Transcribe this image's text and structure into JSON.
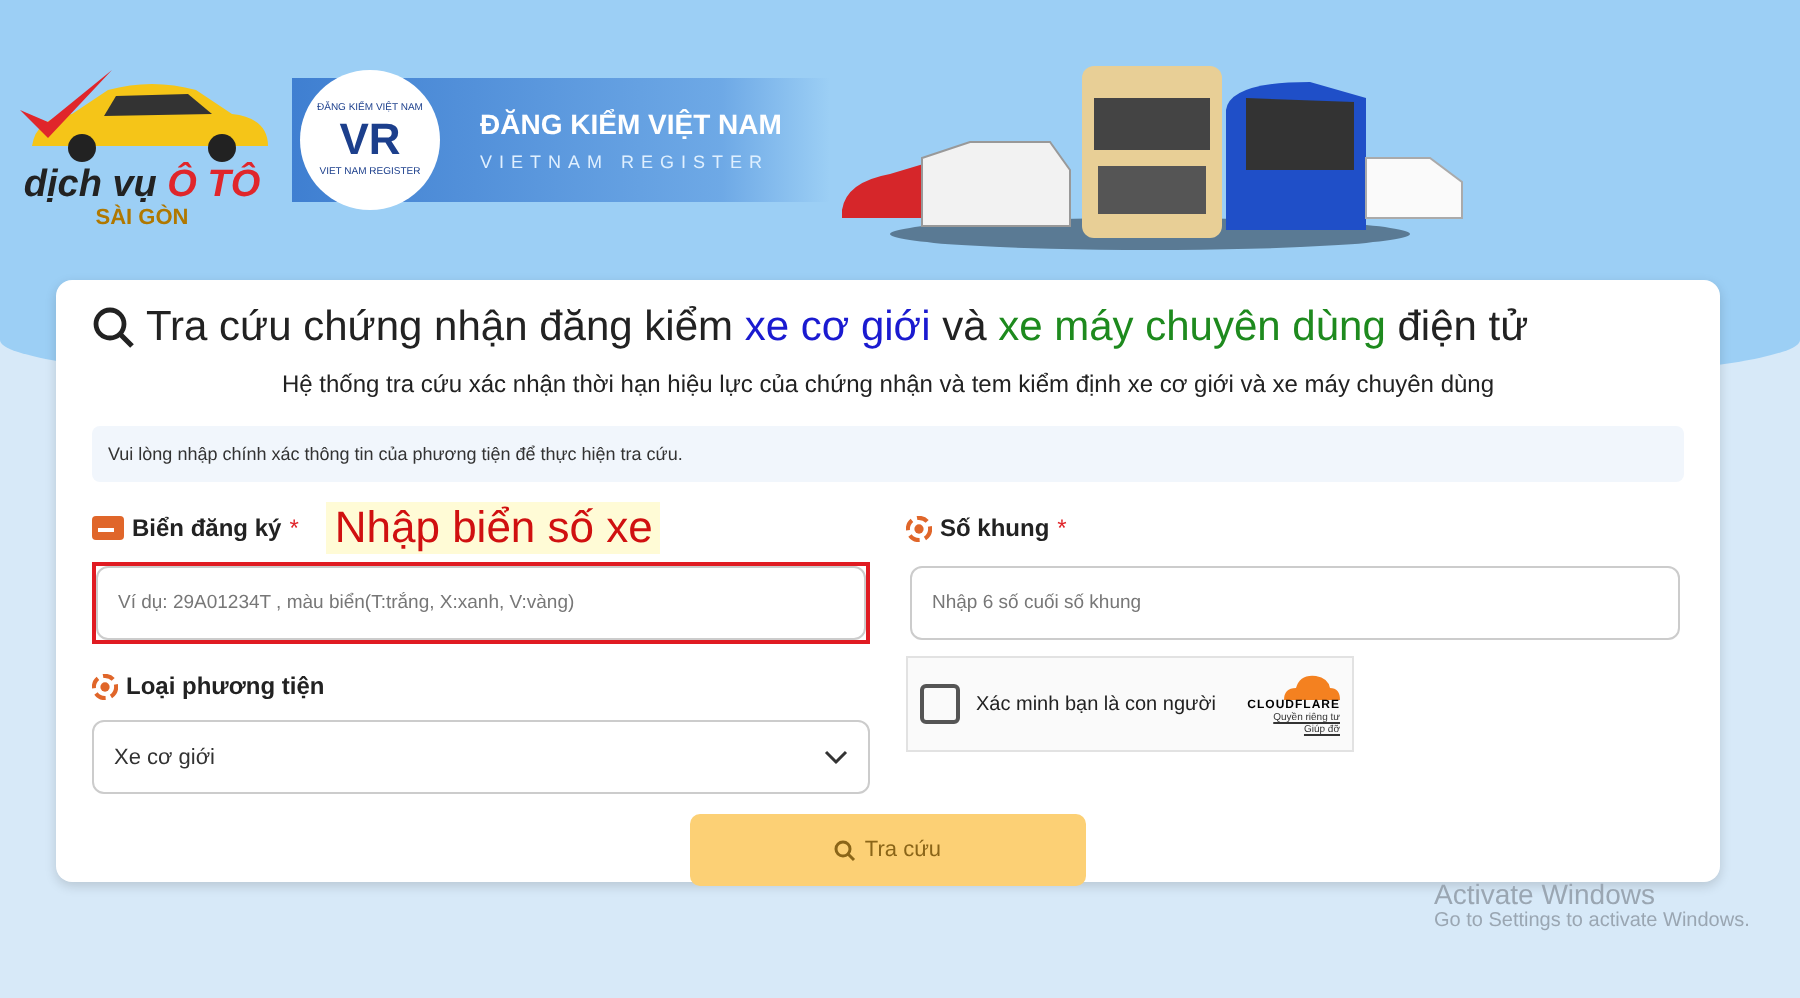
{
  "header": {
    "brand_logo": {
      "line1_a": "dịch vụ",
      "line1_b": "Ô TÔ",
      "line2": "SÀI GÒN"
    },
    "register_logo": {
      "seal_top": "ĐĂNG KIỂM VIỆT NAM",
      "seal_bottom": "VIET NAM REGISTER",
      "seal_mark": "VR",
      "title": "ĐĂNG KIỂM VIỆT NAM",
      "subtitle": "VIETNAM REGISTER"
    }
  },
  "card": {
    "title": [
      {
        "text": "Tra cứu chứng nhận đăng kiểm ",
        "color": "#222222"
      },
      {
        "text": "xe cơ giới",
        "color": "#1a1ad0"
      },
      {
        "text": " và ",
        "color": "#222222"
      },
      {
        "text": "xe máy chuyên dùng",
        "color": "#1e8a1e"
      },
      {
        "text": " điện tử",
        "color": "#222222"
      }
    ],
    "subtitle": "Hệ thống tra cứu xác nhận thời hạn hiệu lực của chứng nhận và tem kiểm định xe cơ giới và xe máy chuyên dùng",
    "notice": "Vui lòng nhập chính xác thông tin của phương tiện để thực hiện tra cứu.",
    "fields": [
      {
        "label": "Biển đăng ký",
        "required_mark": "*",
        "kind": "input",
        "placeholder": "Ví dụ: 29A01234T , màu biển(T:trắng, X:xanh, V:vàng)",
        "highlighted": true,
        "annotation": "Nhập biển số xe"
      },
      {
        "label": "Số khung",
        "required_mark": "*",
        "kind": "input",
        "placeholder": "Nhập 6 số cuối số khung"
      },
      {
        "label": "Loại phương tiện",
        "kind": "select",
        "value": "Xe cơ giới"
      },
      {
        "kind": "captcha",
        "label": "Xác minh bạn là con người",
        "checked": false,
        "brand": "CLOUDFLARE",
        "links": [
          "Quyền riêng tư",
          "Giúp đỡ"
        ]
      }
    ],
    "submit": {
      "label": "Tra cứu",
      "disabled": true
    }
  },
  "os_overlay": {
    "title": "Activate Windows",
    "hint": "Go to Settings to activate Windows."
  }
}
